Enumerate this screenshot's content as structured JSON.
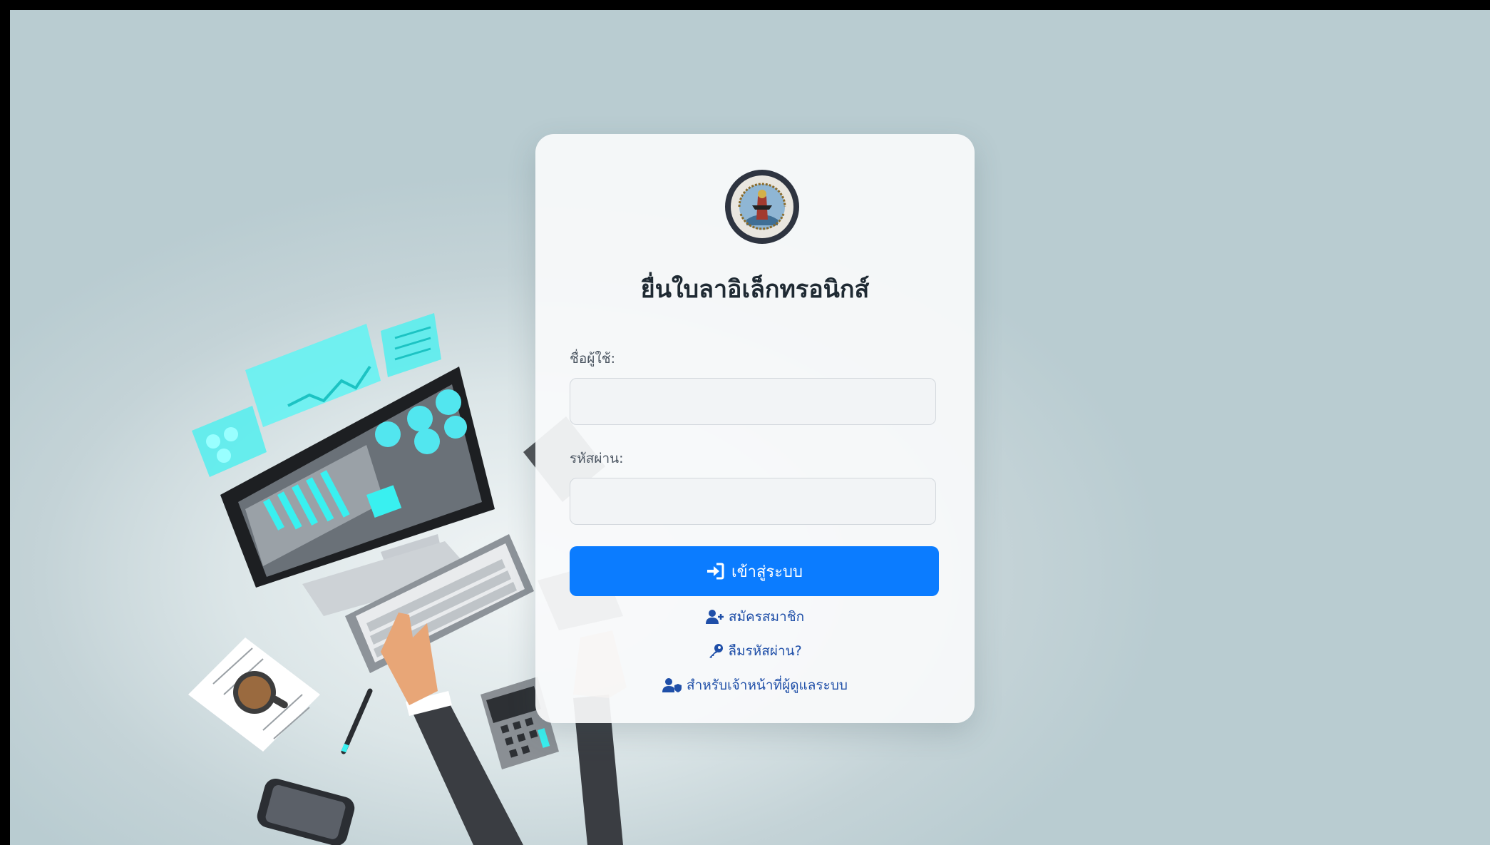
{
  "title": "ยื่นใบลาอิเล็กทรอนิกส์",
  "username": {
    "label": "ชื่อผู้ใช้:",
    "value": "",
    "placeholder": ""
  },
  "password": {
    "label": "รหัสผ่าน:",
    "value": "",
    "placeholder": ""
  },
  "login_button": {
    "label": "เข้าสู่ระบบ",
    "icon": "sign-in-icon"
  },
  "links": {
    "register": {
      "label": "สมัครสมาชิก",
      "icon": "user-plus-icon"
    },
    "forgot": {
      "label": "ลืมรหัสผ่าน?",
      "icon": "key-icon"
    },
    "admin": {
      "label": "สำหรับเจ้าหน้าที่ผู้ดูแลระบบ",
      "icon": "user-shield-icon"
    }
  },
  "colors": {
    "primary": "#0b7cff",
    "link": "#1f4fa8",
    "background": "#c4d3d7",
    "accent_cyan": "#39f0f0"
  }
}
